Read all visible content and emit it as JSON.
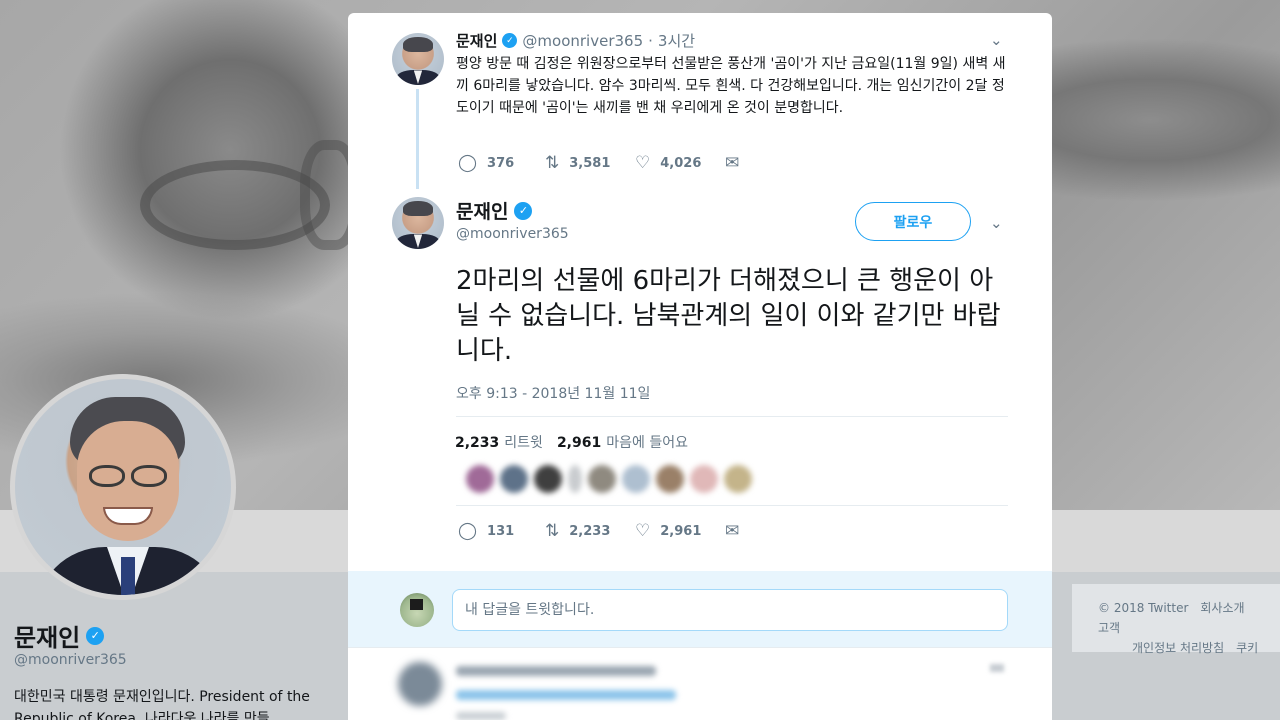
{
  "profile": {
    "name": "문재인",
    "handle": "@moonriver365",
    "bio": "대한민국 대통령 문재인입니다. President of the Republic of Korea. 나라다운 나라를 만들"
  },
  "footer": {
    "copyright": "© 2018 Twitter",
    "about": "회사소개",
    "ads": "고객",
    "privacy": "개인정보 처리방침",
    "cookies": "쿠키"
  },
  "tweet_parent": {
    "name": "문재인",
    "handle": "@moonriver365",
    "separator": "·",
    "time": "3시간",
    "text": "평양 방문 때 김정은 위원장으로부터 선물받은 풍산개 '곰이'가 지난 금요일(11월 9일) 새벽 새끼 6마리를 낳았습니다. 암수 3마리씩. 모두 흰색. 다 건강해보입니다. 개는 임신기간이 2달 정도이기 때문에 '곰이'는 새끼를 밴 채 우리에게 온 것이 분명합니다.",
    "replies": "376",
    "retweets": "3,581",
    "likes": "4,026"
  },
  "tweet_main": {
    "name": "문재인",
    "handle": "@moonriver365",
    "follow_label": "팔로우",
    "text": "2마리의 선물에 6마리가 더해졌으니 큰 행운이 아닐 수 없습니다. 남북관계의 일이 이와 같기만 바랍니다.",
    "timestamp": "오후 9:13 - 2018년 11월 11일",
    "retweet_count": "2,233",
    "retweet_label": "리트윗",
    "like_count": "2,961",
    "like_label": "마음에 들어요",
    "replies": "131",
    "retweets": "2,233",
    "likes": "2,961"
  },
  "reply_box": {
    "placeholder": "내 답글을 트윗합니다."
  },
  "icons": {
    "reply": "reply-icon",
    "retweet": "retweet-icon",
    "like": "heart-icon",
    "message": "envelope-icon",
    "verified": "verified-badge-icon",
    "more": "chevron-down-icon"
  },
  "colors": {
    "accent": "#1da1f2",
    "thread_line": "#c9e1f3",
    "reply_bg": "#e8f5fd"
  }
}
